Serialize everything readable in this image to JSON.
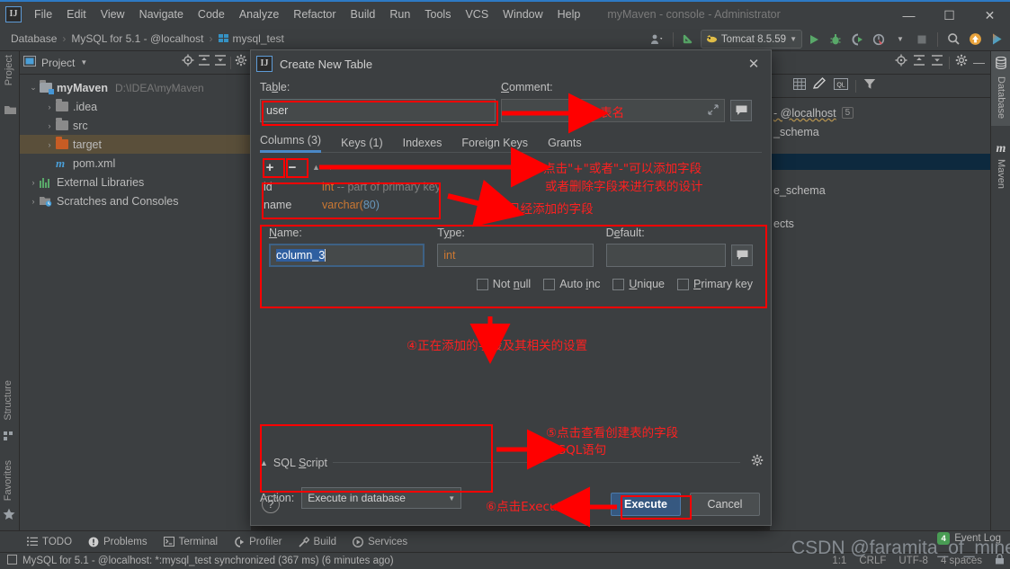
{
  "titlebar": {
    "logo": "IJ",
    "menus": [
      "File",
      "Edit",
      "View",
      "Navigate",
      "Code",
      "Analyze",
      "Refactor",
      "Build",
      "Run",
      "Tools",
      "VCS",
      "Window",
      "Help"
    ],
    "window_title": "myMaven - console - Administrator",
    "minimize": "—",
    "maximize": "☐",
    "close": "✕"
  },
  "navbar": {
    "breadcrumbs": [
      "Database",
      "MySQL for 5.1 - @localhost",
      "mysql_test"
    ],
    "separator": "›",
    "run_config": "Tomcat 8.5.59",
    "icons": [
      "user-icon",
      "update-icon",
      "run-icon",
      "debug-icon",
      "coverage-icon",
      "profile-icon",
      "stop-icon",
      "search-icon",
      "updates-icon",
      "idea-icon"
    ]
  },
  "left_strip": {
    "top_label": "Project",
    "structure_label": "Structure",
    "favorites_label": "Favorites"
  },
  "project_panel": {
    "title": "Project",
    "tree": [
      {
        "label": "myMaven",
        "path": "D:\\IDEA\\myMaven",
        "kind": "module",
        "arrow": "⌄",
        "bold": true,
        "selected": false
      },
      {
        "label": ".idea",
        "path": "",
        "kind": "folder",
        "arrow": "›",
        "bold": false,
        "selected": false
      },
      {
        "label": "src",
        "path": "",
        "kind": "folder",
        "arrow": "›",
        "bold": false,
        "selected": false
      },
      {
        "label": "target",
        "path": "",
        "kind": "folder-orange",
        "arrow": "›",
        "bold": false,
        "selected": true
      },
      {
        "label": "pom.xml",
        "path": "",
        "kind": "maven",
        "arrow": "",
        "bold": false,
        "selected": false
      },
      {
        "label": "External Libraries",
        "path": "",
        "kind": "library",
        "arrow": "›",
        "bold": false,
        "selected": false
      },
      {
        "label": "Scratches and Consoles",
        "path": "",
        "kind": "scratch",
        "arrow": "›",
        "bold": false,
        "selected": false
      }
    ]
  },
  "db_panel": {
    "rows": [
      {
        "text": "- @localhost",
        "badge": "5",
        "selected": false
      },
      {
        "text": "_schema",
        "badge": "",
        "selected": false
      },
      {
        "text": "",
        "badge": "",
        "selected": true
      },
      {
        "text": "e_schema",
        "badge": "",
        "selected": false
      },
      {
        "text": "ects",
        "badge": "",
        "selected": false
      }
    ]
  },
  "right_strip": {
    "database_label": "Database",
    "maven_label": "Maven",
    "maven_glyph": "m"
  },
  "dialog": {
    "title": "Create New Table",
    "close": "✕",
    "table_label": "Table:",
    "table_value": "user",
    "comment_label": "Comment:",
    "comment_value": "",
    "tabs": [
      {
        "label": "Columns (3)",
        "active": true
      },
      {
        "label": "Keys (1)",
        "active": false
      },
      {
        "label": "Indexes",
        "active": false
      },
      {
        "label": "Foreign Keys",
        "active": false
      },
      {
        "label": "Grants",
        "active": false
      }
    ],
    "add_button": "+",
    "remove_button": "−",
    "sort_up": "▲",
    "sort_down": "▼",
    "columns": [
      {
        "name": "id",
        "type": "int",
        "comment": " -- part of primary key",
        "suffix": ""
      },
      {
        "name": "name",
        "type": "varchar(",
        "comment": "",
        "suffix": "80)"
      }
    ],
    "detail": {
      "name_label": "Name:",
      "name_value": "column_3",
      "type_label": "Type:",
      "type_value": "int",
      "default_label": "Default:",
      "default_value": "",
      "checkboxes": [
        {
          "label": "Not null",
          "checked": false
        },
        {
          "label": "Auto inc",
          "checked": false
        },
        {
          "label": "Unique",
          "checked": false
        },
        {
          "label": "Primary key",
          "checked": false
        }
      ]
    },
    "sql_script": {
      "title": "SQL Script",
      "collapse_arrow": "▲",
      "action_label": "Action:",
      "action_value": "Execute in database",
      "dropdown_arrow": "▼"
    },
    "footer": {
      "help": "?",
      "execute": "Execute",
      "cancel": "Cancel"
    }
  },
  "annotations": [
    {
      "id": "a1",
      "text": "①表名"
    },
    {
      "id": "a2",
      "text": "②点击\"+\"或者\"-\"可以添加字段"
    },
    {
      "id": "a2b",
      "text": "或者删除字段来进行表的设计"
    },
    {
      "id": "a3",
      "text": "③已经添加的字段"
    },
    {
      "id": "a4",
      "text": "④正在添加的字段及其相关的设置"
    },
    {
      "id": "a5",
      "text": "⑤点击查看创建表的字段"
    },
    {
      "id": "a5b",
      "text": "的SQL语句"
    },
    {
      "id": "a6",
      "text": "⑥点击Execute"
    }
  ],
  "bottom_bar": {
    "items": [
      {
        "label": "TODO",
        "icon": "list-icon"
      },
      {
        "label": "Problems",
        "icon": "warning-icon"
      },
      {
        "label": "Terminal",
        "icon": "terminal-icon"
      },
      {
        "label": "Profiler",
        "icon": "profiler-icon"
      },
      {
        "label": "Build",
        "icon": "hammer-icon"
      },
      {
        "label": "Services",
        "icon": "services-icon"
      }
    ],
    "event_log": "Event Log",
    "event_count": "4"
  },
  "status_bar": {
    "message": "MySQL for 5.1 - @localhost: *:mysql_test synchronized (367 ms) (6 minutes ago)",
    "caret": "1:1",
    "line_sep": "CRLF",
    "encoding": "UTF-8",
    "indent": "4 spaces"
  },
  "watermark": "CSDN @faramita_of_mine",
  "colors": {
    "accent_blue": "#4a88c7",
    "annotation_red": "#ff2020",
    "selection_brown": "#5a4f3a",
    "primary_button": "#365880",
    "panel_bg": "#3c3f41",
    "editor_bg": "#2b2b2b"
  }
}
